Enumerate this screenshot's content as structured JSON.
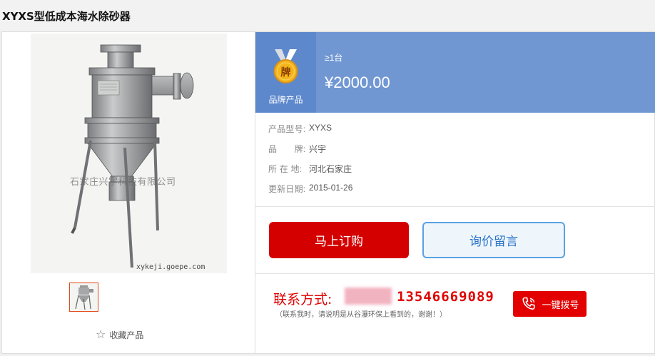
{
  "page": {
    "title": "XYXS型低成本海水除砂器"
  },
  "product_images": {
    "watermark": "石家庄兴宇科技有限公司",
    "site_watermark": "xykeji.goepe.com"
  },
  "favorite": {
    "icon": "star-icon",
    "label": "收藏产品"
  },
  "pricing": {
    "badge_char": "牌",
    "badge_label": "品牌产品",
    "moq": "≥1台",
    "price": "¥2000.00",
    "panel_color": "#7197d3"
  },
  "details": [
    {
      "key": "产品型号:",
      "value": "XYXS"
    },
    {
      "key": "品　　牌:",
      "value": "兴宇"
    },
    {
      "key": "所 在 地:",
      "value": "河北石家庄"
    },
    {
      "key": "更新日期:",
      "value": "2015-01-26"
    }
  ],
  "actions": {
    "order_label": "马上订购",
    "inquiry_label": "询价留言"
  },
  "contact": {
    "label": "联系方式:",
    "phone": "13546669089",
    "note": "（联系我时，请说明是从谷瀑环保上看到的，谢谢！）",
    "call_label": "一键拨号",
    "accent_color": "#e00000"
  }
}
